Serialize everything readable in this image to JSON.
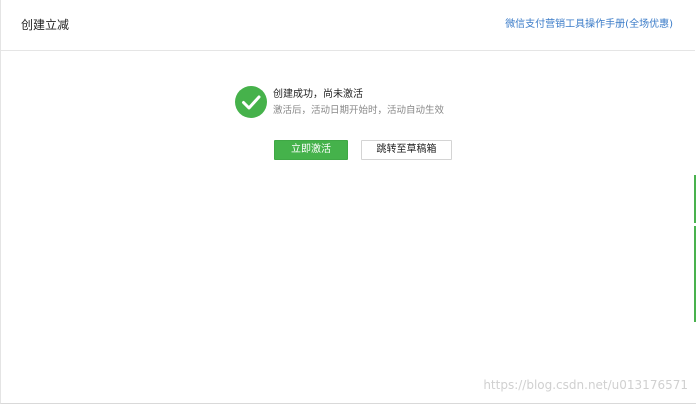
{
  "header": {
    "title": "创建立减",
    "manual_link": "微信支付营销工具操作手册(全场优惠)"
  },
  "result": {
    "icon": "check-circle-icon",
    "title": "创建成功，尚未激活",
    "description": "激活后，活动日期开始时，活动自动生效"
  },
  "actions": {
    "activate_label": "立即激活",
    "draft_label": "跳转至草稿箱"
  },
  "watermark": "https://blog.csdn.net/u013176571",
  "colors": {
    "success_green": "#46b24b",
    "link_blue": "#3a7bc8"
  }
}
